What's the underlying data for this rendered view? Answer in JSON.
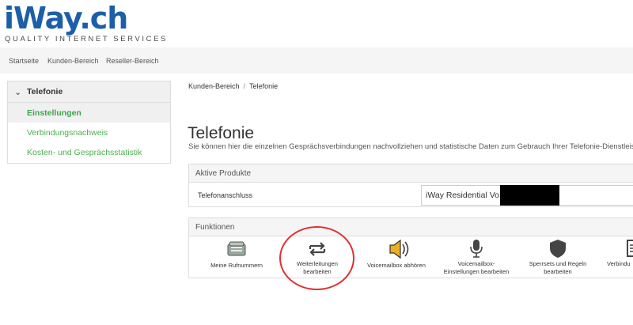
{
  "logo": {
    "text": "iWay.ch",
    "tagline": "QUALITY INTERNET SERVICES"
  },
  "topnav": [
    "Startseite",
    "Kunden-Bereich",
    "Reseller-Bereich"
  ],
  "sidebar": {
    "title": "Telefonie",
    "items": [
      "Einstellungen",
      "Verbindungsnachweis",
      "Kosten- und Gesprächsstatistik"
    ]
  },
  "breadcrumb": [
    "Kunden-Bereich",
    "Telefonie"
  ],
  "page": {
    "title": "Telefonie",
    "description": "Sie können hier die einzelnen Gesprächsverbindungen nachvollziehen und statistische Daten zum Gebrauch Ihrer Telefonie-Dienstleis"
  },
  "products": {
    "title": "Aktive Produkte",
    "label": "Telefonanschluss",
    "value": "iWay Residential VoIP"
  },
  "functions": {
    "title": "Funktionen",
    "items": [
      {
        "line1": "Meine Rufnummern",
        "line2": "",
        "icon": "phone-icon"
      },
      {
        "line1": "Weiterleitungen",
        "line2": "bearbeiten",
        "icon": "forward-icon"
      },
      {
        "line1": "Voicemailbox abhören",
        "line2": "",
        "icon": "speaker-icon"
      },
      {
        "line1": "Voicemailbox-",
        "line2": "Einstellungen bearbeiten",
        "icon": "microphone-icon"
      },
      {
        "line1": "Sperrsets und Regeln",
        "line2": "bearbeiten",
        "icon": "shield-icon"
      },
      {
        "line1": "Verbindu",
        "line2": "",
        "icon": "document-icon"
      }
    ]
  },
  "colors": {
    "brand": "#1c5fa8",
    "accent_green": "#4caf50",
    "highlight_circle": "#e03030"
  }
}
